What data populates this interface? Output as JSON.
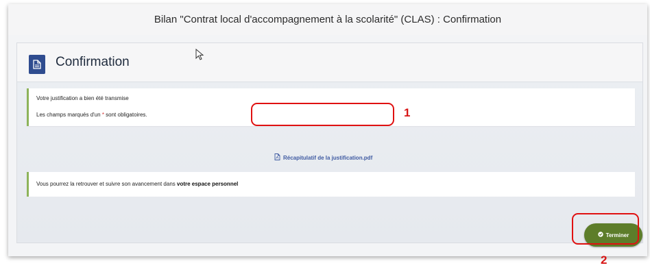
{
  "window": {
    "title": "Bilan \"Contrat local d'accompagnement à la scolarité\" (CLAS) : Confirmation"
  },
  "panel": {
    "title": "Confirmation",
    "icon": "document-icon"
  },
  "notice": {
    "line1": "Votre justification a bien été transmise",
    "line2_before": "Les champs marqués d'un ",
    "required_star": "*",
    "line2_after": " sont obligatoires."
  },
  "download": {
    "icon": "pdf-file-icon",
    "label": "Récapitulatif de la justification.pdf"
  },
  "info": {
    "text": "Vous pourrez la retrouver et suivre son avancement dans ",
    "bold_text": "votre espace personnel"
  },
  "actions": {
    "finish_icon": "check-circle-icon",
    "finish_label": "Terminer"
  },
  "annotations": {
    "marker_1": "1",
    "marker_2": "2"
  },
  "colors": {
    "accent_blue": "#2f4c8f",
    "link_blue": "#3e5aa1",
    "success_green": "#5d7d2a",
    "notice_border": "#8db35a",
    "annotation_red": "#e01010"
  }
}
